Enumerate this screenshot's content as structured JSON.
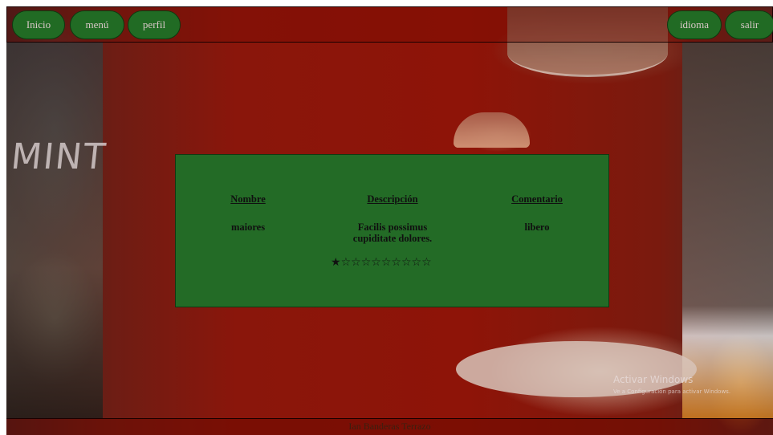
{
  "nav": {
    "inicio": "Inicio",
    "menu": "menú",
    "perfil": "perfil",
    "idioma": "idioma",
    "salir": "salir"
  },
  "card": {
    "columns": [
      {
        "header": "Nombre",
        "value": "maiores"
      },
      {
        "header": "Descripción",
        "value": "Facilis possimus cupiditate dolores."
      },
      {
        "header": "Comentario",
        "value": "libero"
      }
    ],
    "rating": {
      "value": 1,
      "max": 10
    }
  },
  "footer": {
    "text": "Ian Banderas Terrazo"
  },
  "watermark": {
    "title": "Activar Windows",
    "subtitle": "Ve a Configuración para activar Windows."
  },
  "background_sign": "MINT",
  "colors": {
    "button": "#216b24",
    "card": "#236b26",
    "overlay": "#8e1408"
  }
}
